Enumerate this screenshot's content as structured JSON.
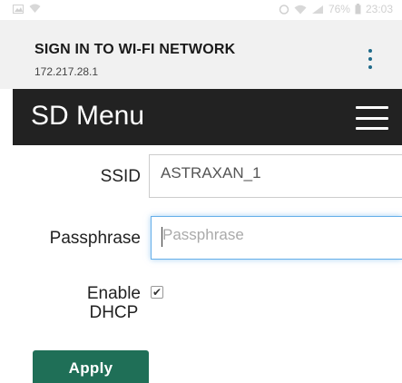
{
  "status_bar": {
    "battery_text": "76%",
    "time": "23:03"
  },
  "header": {
    "title": "SIGN IN TO WI-FI NETWORK",
    "subtitle": "172.217.28.1",
    "menu_icon": "overflow-menu-icon"
  },
  "navbar": {
    "brand": "SD Menu",
    "toggle_icon": "hamburger-icon"
  },
  "form": {
    "ssid_label": "SSID",
    "ssid_value": "ASTRAXAN_1",
    "passphrase_label": "Passphrase",
    "passphrase_placeholder": "Passphrase",
    "passphrase_value": "",
    "dhcp_label_line1": "Enable",
    "dhcp_label_line2": "DHCP",
    "dhcp_checked": true,
    "apply_label": "Apply"
  },
  "colors": {
    "navbar_bg": "#222222",
    "apply_bg": "#1f6f57",
    "kebab_dots": "#1f6b8a",
    "focus_border": "#66afe9"
  }
}
